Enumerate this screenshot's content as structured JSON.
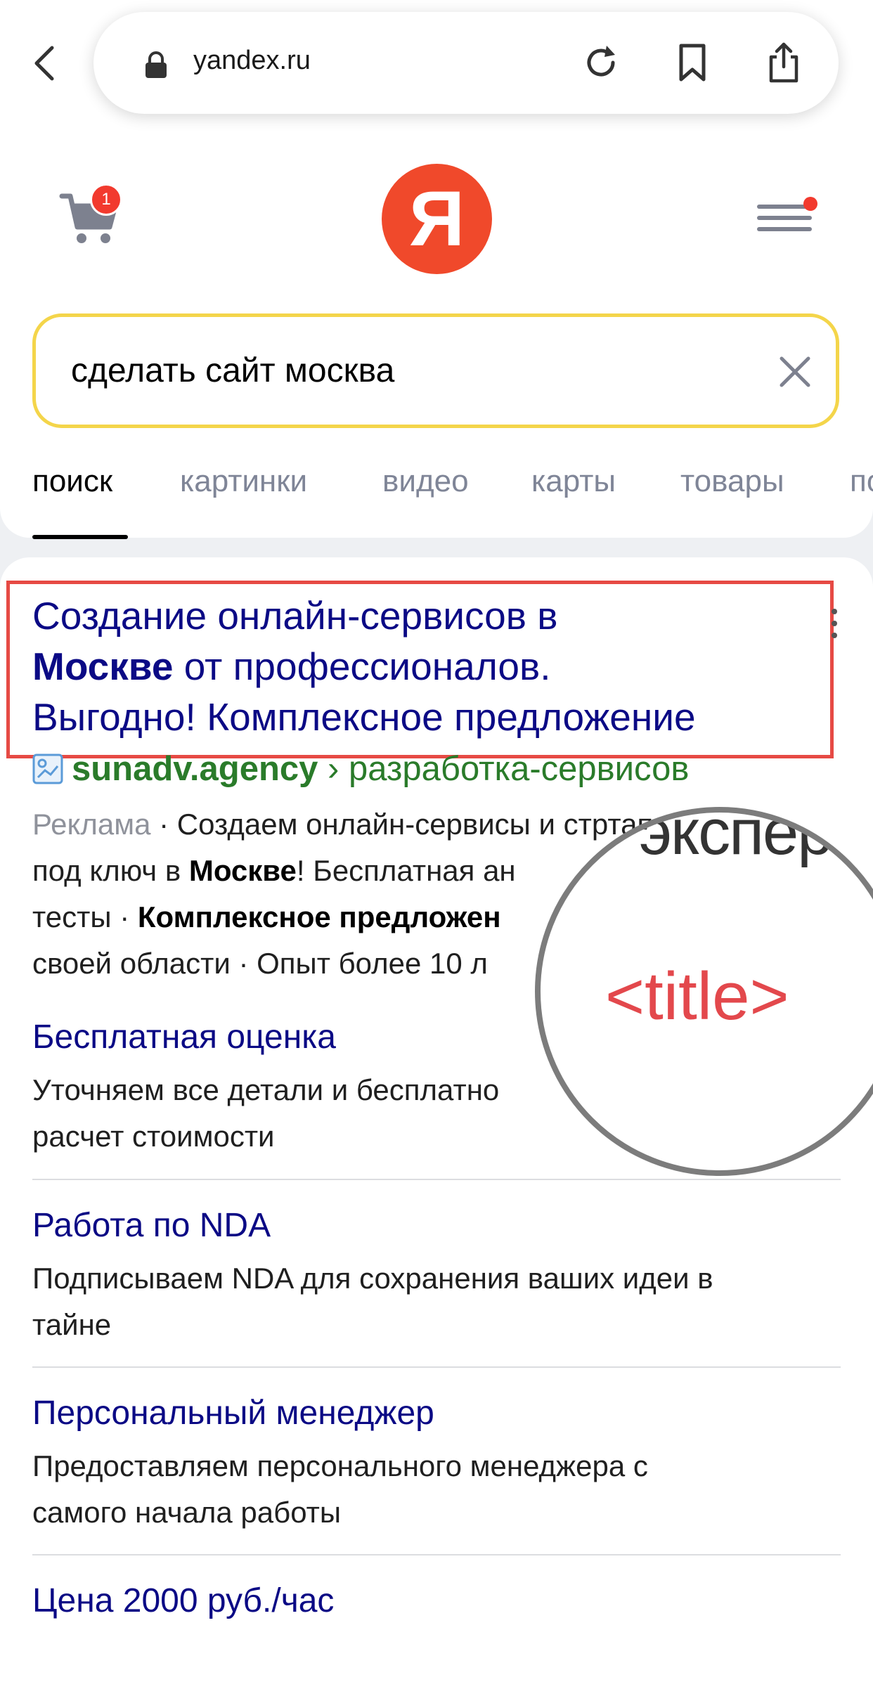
{
  "browser": {
    "url": "yandex.ru"
  },
  "header": {
    "cart_count": "1",
    "logo_letter": "Я"
  },
  "search": {
    "query": "сделать сайт москва"
  },
  "tabs": [
    "поиск",
    "картинки",
    "видео",
    "карты",
    "товары",
    "по"
  ],
  "ad": {
    "title_line1": "Создание онлайн-сервисов в",
    "title_bold": "Москве",
    "title_line2_rest": " от профессионалов.",
    "title_line3": "Выгодно! Комплексное предложение",
    "domain": "sunadv.agency",
    "breadcrumb": " › разработка-сервисов",
    "label": "Реклама",
    "snippet_1": " · Создаем онлайн-сервисы и ст",
    "snippet_1b": "ртапы",
    "snippet_2a": "под ключ в ",
    "snippet_2bold": "Москве",
    "snippet_2b": "! Бесплатная ан",
    "snippet_3a": "тесты · ",
    "snippet_3bold": "Комплексное предложен",
    "snippet_4": "своей области · Опыт более 10 л"
  },
  "sitelinks": [
    {
      "title": "Бесплатная оценка",
      "line1": "Уточняем все детали и бесплатно",
      "line2": "расчет стоимости"
    },
    {
      "title": "Работа по NDA",
      "line1": "Подписываем NDA для сохранения ваших идеи в",
      "line2": "тайне"
    },
    {
      "title": "Персональный менеджер",
      "line1": "Предоставляем персонального менеджера с",
      "line2": "самого начала работы"
    },
    {
      "title": "Цена 2000 руб./час"
    }
  ],
  "magnifier": {
    "word": "эксперт",
    "tag": "<title>"
  },
  "colors": {
    "accent_yellow": "#f4d54a",
    "logo_red": "#f0492b",
    "link_blue": "#0b0a85",
    "domain_green": "#2a7b2a",
    "highlight_red": "#e64a44"
  }
}
